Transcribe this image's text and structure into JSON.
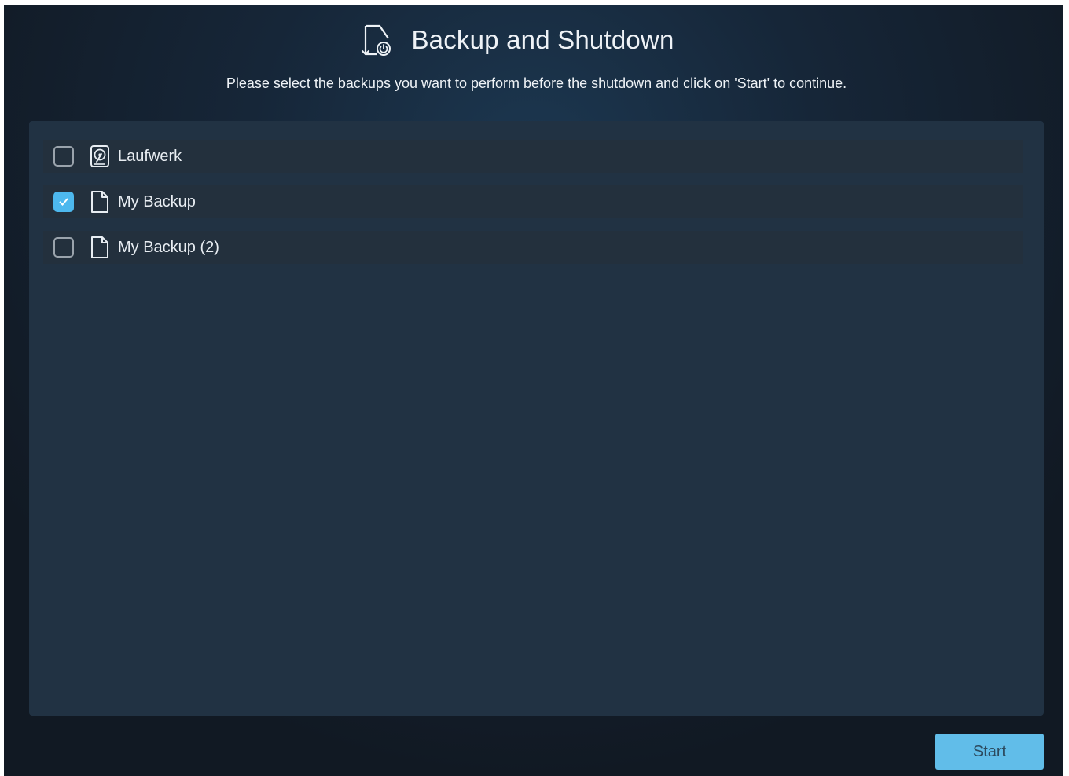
{
  "header": {
    "title": "Backup and Shutdown",
    "icon": "backup-shutdown-icon",
    "subtitle": "Please select the backups you want to perform before the shutdown and click on 'Start' to continue."
  },
  "backups": [
    {
      "label": "Laufwerk",
      "icon": "drive-icon",
      "checked": false
    },
    {
      "label": "My Backup",
      "icon": "file-icon",
      "checked": true
    },
    {
      "label": "My Backup (2)",
      "icon": "file-icon",
      "checked": false
    }
  ],
  "footer": {
    "start_label": "Start"
  },
  "colors": {
    "accent": "#4db8ee",
    "button": "#61bde9",
    "panel": "#213243",
    "row": "#23303d"
  }
}
